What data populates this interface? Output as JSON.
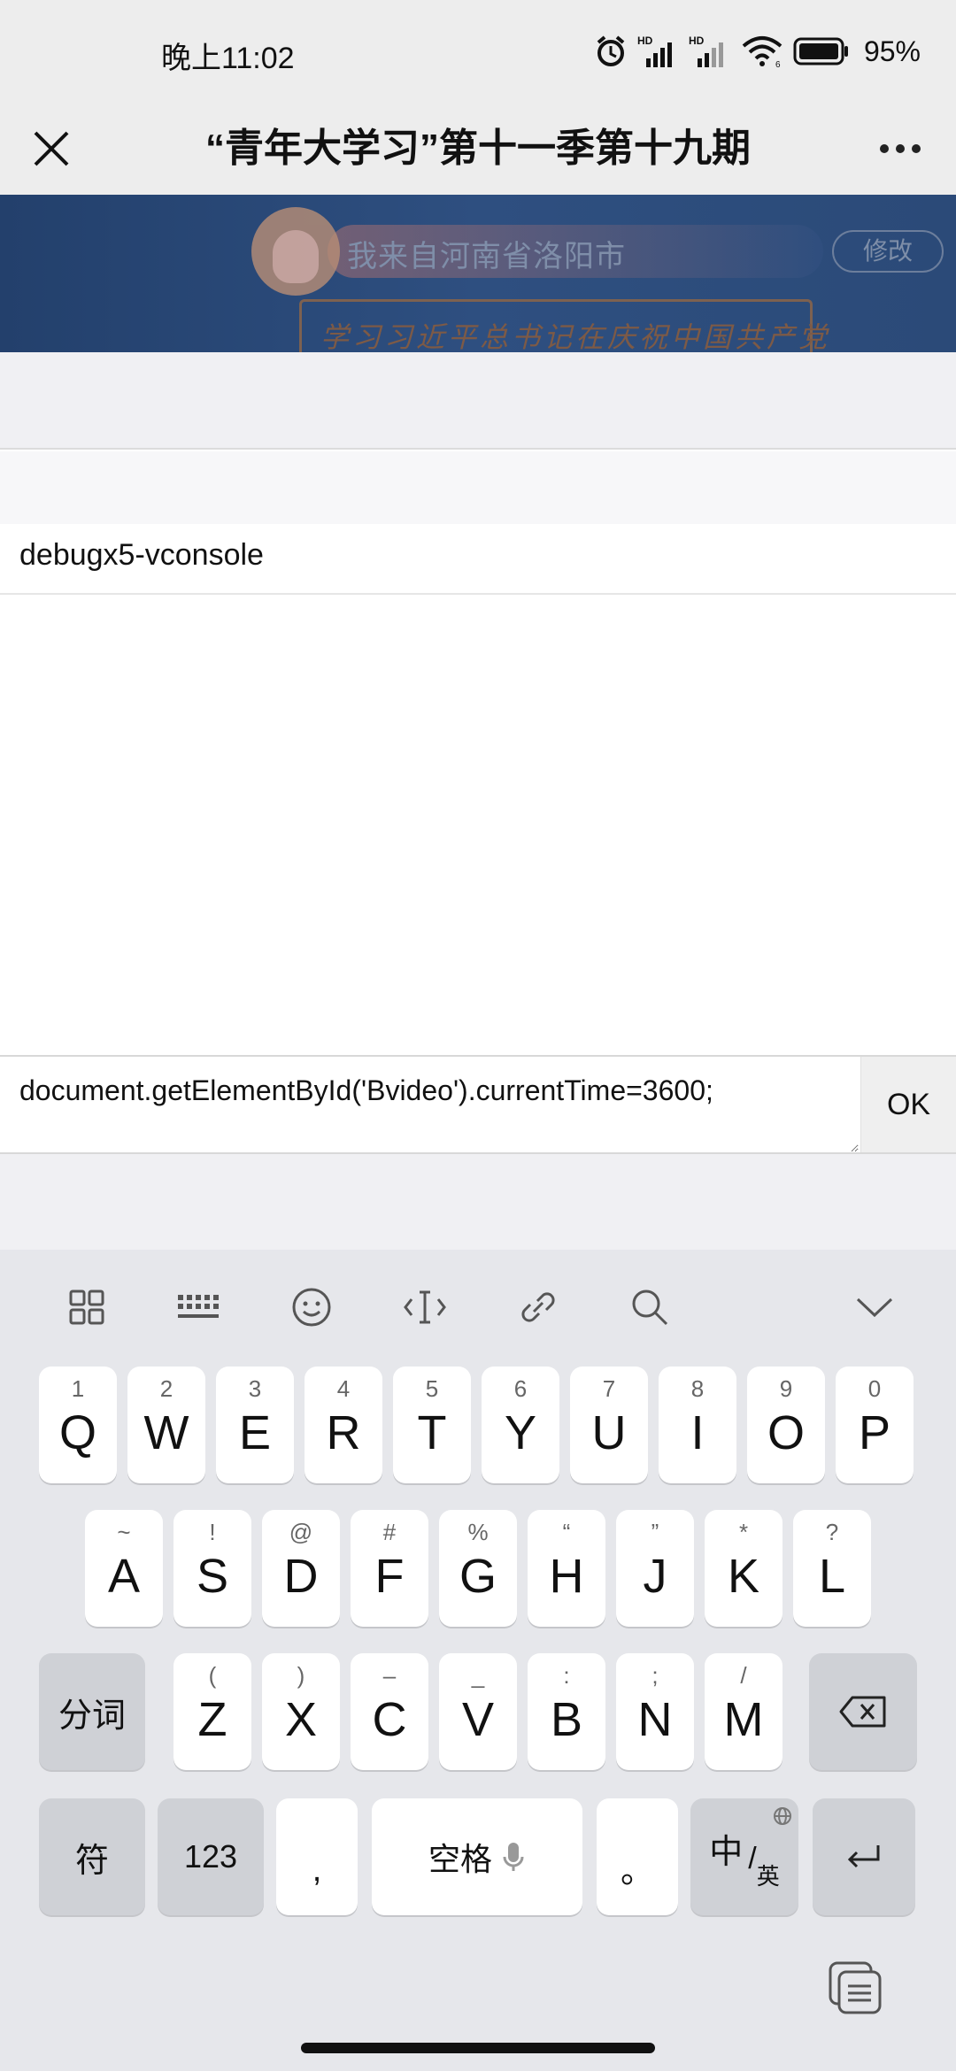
{
  "status_bar": {
    "time": "晚上11:02",
    "battery": "95%"
  },
  "nav": {
    "title": "“青年大学习”第十一季第十九期"
  },
  "banner": {
    "location_text": "我来自河南省洛阳市",
    "edit_label": "修改",
    "slogan": "学习习近平总书记在庆祝中国共产党"
  },
  "vconsole": {
    "row_label": "debugx5-vconsole"
  },
  "command": {
    "value": "document.getElementById('Bvideo').currentTime=3600;",
    "ok_label": "OK"
  },
  "keyboard": {
    "row1": [
      {
        "key": "Q",
        "hint": "1"
      },
      {
        "key": "W",
        "hint": "2"
      },
      {
        "key": "E",
        "hint": "3"
      },
      {
        "key": "R",
        "hint": "4"
      },
      {
        "key": "T",
        "hint": "5"
      },
      {
        "key": "Y",
        "hint": "6"
      },
      {
        "key": "U",
        "hint": "7"
      },
      {
        "key": "I",
        "hint": "8"
      },
      {
        "key": "O",
        "hint": "9"
      },
      {
        "key": "P",
        "hint": "0"
      }
    ],
    "row2": [
      {
        "key": "A",
        "hint": "~"
      },
      {
        "key": "S",
        "hint": "!"
      },
      {
        "key": "D",
        "hint": "@"
      },
      {
        "key": "F",
        "hint": "#"
      },
      {
        "key": "G",
        "hint": "%"
      },
      {
        "key": "H",
        "hint": "“"
      },
      {
        "key": "J",
        "hint": "”"
      },
      {
        "key": "K",
        "hint": "*"
      },
      {
        "key": "L",
        "hint": "?"
      }
    ],
    "row3": [
      {
        "key": "Z",
        "hint": "("
      },
      {
        "key": "X",
        "hint": ")"
      },
      {
        "key": "C",
        "hint": "–"
      },
      {
        "key": "V",
        "hint": "_"
      },
      {
        "key": "B",
        "hint": ":"
      },
      {
        "key": "N",
        "hint": ";"
      },
      {
        "key": "M",
        "hint": "/"
      }
    ],
    "segment_label": "分词",
    "symbol_label": "符",
    "num_label": "123",
    "comma_label": ",",
    "space_label": "空格",
    "period_label": "。",
    "lang_zh": "中",
    "lang_en": "英"
  }
}
